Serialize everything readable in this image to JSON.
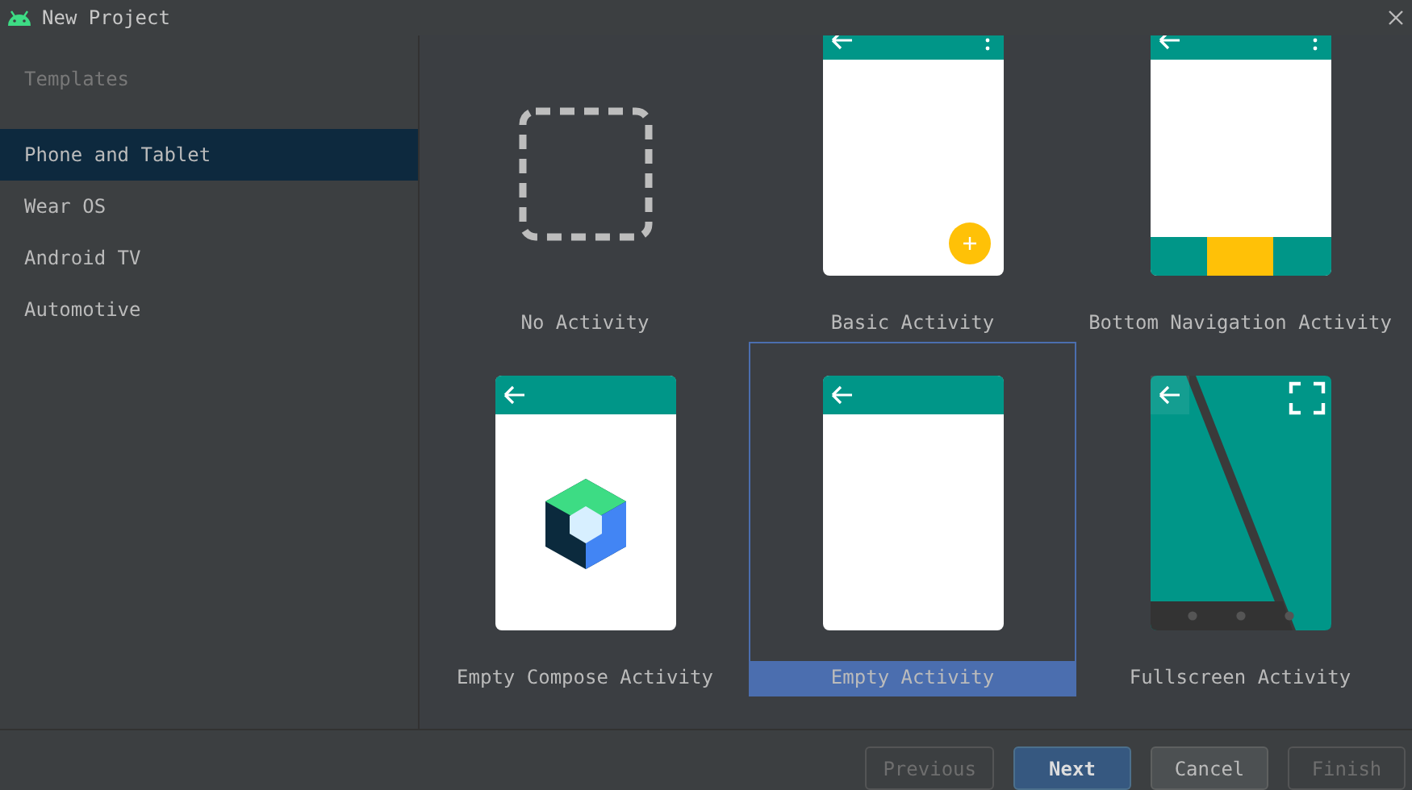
{
  "window": {
    "title": "New Project"
  },
  "sidebar": {
    "heading": "Templates",
    "items": [
      {
        "label": "Phone and Tablet",
        "selected": true
      },
      {
        "label": "Wear OS",
        "selected": false
      },
      {
        "label": "Android TV",
        "selected": false
      },
      {
        "label": "Automotive",
        "selected": false
      }
    ]
  },
  "templates": [
    {
      "kind": "none",
      "label": "No Activity",
      "selected": false
    },
    {
      "kind": "basic",
      "label": "Basic Activity",
      "selected": false
    },
    {
      "kind": "bottomnav",
      "label": "Bottom Navigation Activity",
      "selected": false
    },
    {
      "kind": "compose",
      "label": "Empty Compose Activity",
      "selected": false
    },
    {
      "kind": "empty",
      "label": "Empty Activity",
      "selected": true
    },
    {
      "kind": "fullscreen",
      "label": "Fullscreen Activity",
      "selected": false
    }
  ],
  "buttons": [
    {
      "label": "Previous",
      "primary": false,
      "disabled": true
    },
    {
      "label": "Next",
      "primary": true,
      "disabled": false
    },
    {
      "label": "Cancel",
      "primary": false,
      "disabled": false
    },
    {
      "label": "Finish",
      "primary": false,
      "disabled": true
    }
  ]
}
